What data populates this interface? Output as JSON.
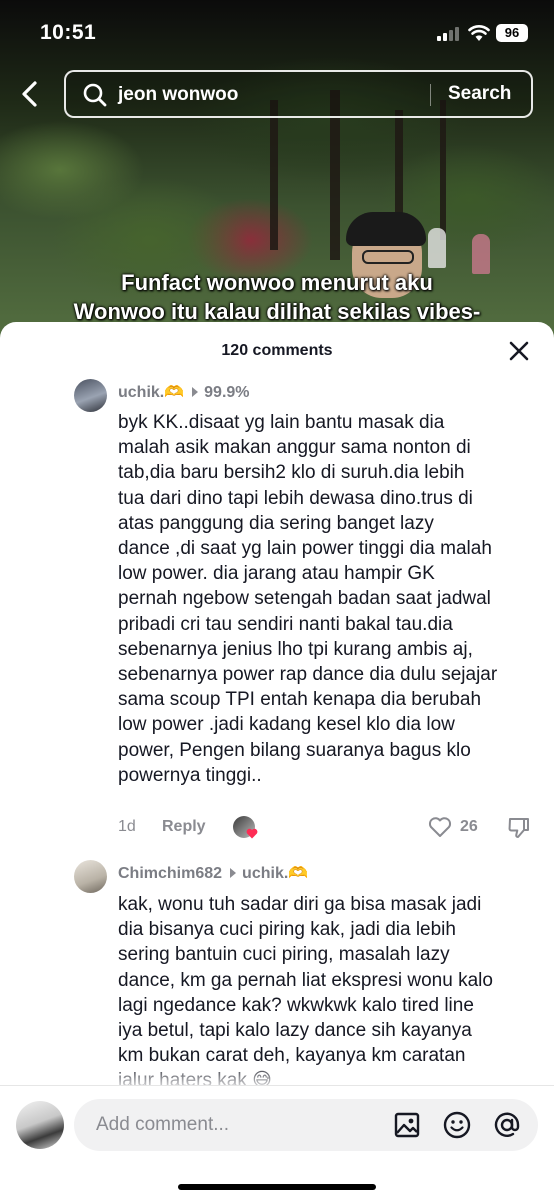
{
  "status": {
    "time": "10:51",
    "battery": "96"
  },
  "search": {
    "query": "jeon wonwoo",
    "button": "Search"
  },
  "video": {
    "caption_lines": [
      "Funfact wonwoo menurut aku",
      "Wonwoo itu kalau dilihat sekilas vibes-"
    ]
  },
  "comments_panel": {
    "title": "120 comments",
    "comments": [
      {
        "username": "uchik.",
        "username_emoji": "🫶",
        "reply_to": "99.9%",
        "body": "byk KK..disaat yg lain bantu masak dia\nmalah asik makan anggur sama nonton di\ntab,dia baru bersih2 klo di suruh.dia lebih\ntua dari dino tapi lebih dewasa dino.trus di\natas panggung dia sering banget lazy\ndance ,di saat yg lain power tinggi dia malah\nlow power. dia jarang atau hampir GK\npernah ngebow setengah badan saat jadwal\npribadi cri tau sendiri nanti bakal tau.dia\nsebenarnya jenius lho tpi kurang ambis aj,\nsebenarnya power rap dance dia dulu sejajar\nsama scoup TPI entah kenapa dia berubah\nlow power .jadi kadang kesel klo dia low\npower, Pengen bilang suaranya bagus klo\npowernya tinggi..",
        "time": "1d",
        "reply_label": "Reply",
        "likes": "26"
      },
      {
        "username": "Chimchim682",
        "reply_to": "uchik.",
        "reply_to_emoji": "🫶",
        "body": "kak, wonu tuh sadar diri ga bisa masak jadi\ndia bisanya cuci piring kak, jadi dia lebih\nsering bantuin cuci piring, masalah lazy\ndance, km ga pernah liat ekspresi wonu kalo\nlagi ngedance kak? wkwkwk kalo tired line\niya betul, tapi kalo lazy dance sih kayanya\nkm bukan carat deh, kayanya km caratan\njalur haters kak 😅"
      }
    ]
  },
  "input_bar": {
    "placeholder": "Add comment..."
  },
  "icons": {
    "back": "chevron-left-icon",
    "search": "search-icon",
    "close": "close-icon",
    "like": "heart-outline-icon",
    "dislike": "thumbs-down-icon",
    "image": "image-icon",
    "emoji": "emoji-smile-icon",
    "mention": "at-sign-icon"
  },
  "colors": {
    "text_primary": "#161823",
    "text_secondary": "#8a8b91",
    "emoji_accent": "#f2b705",
    "liked_heart": "#fe2c55"
  }
}
